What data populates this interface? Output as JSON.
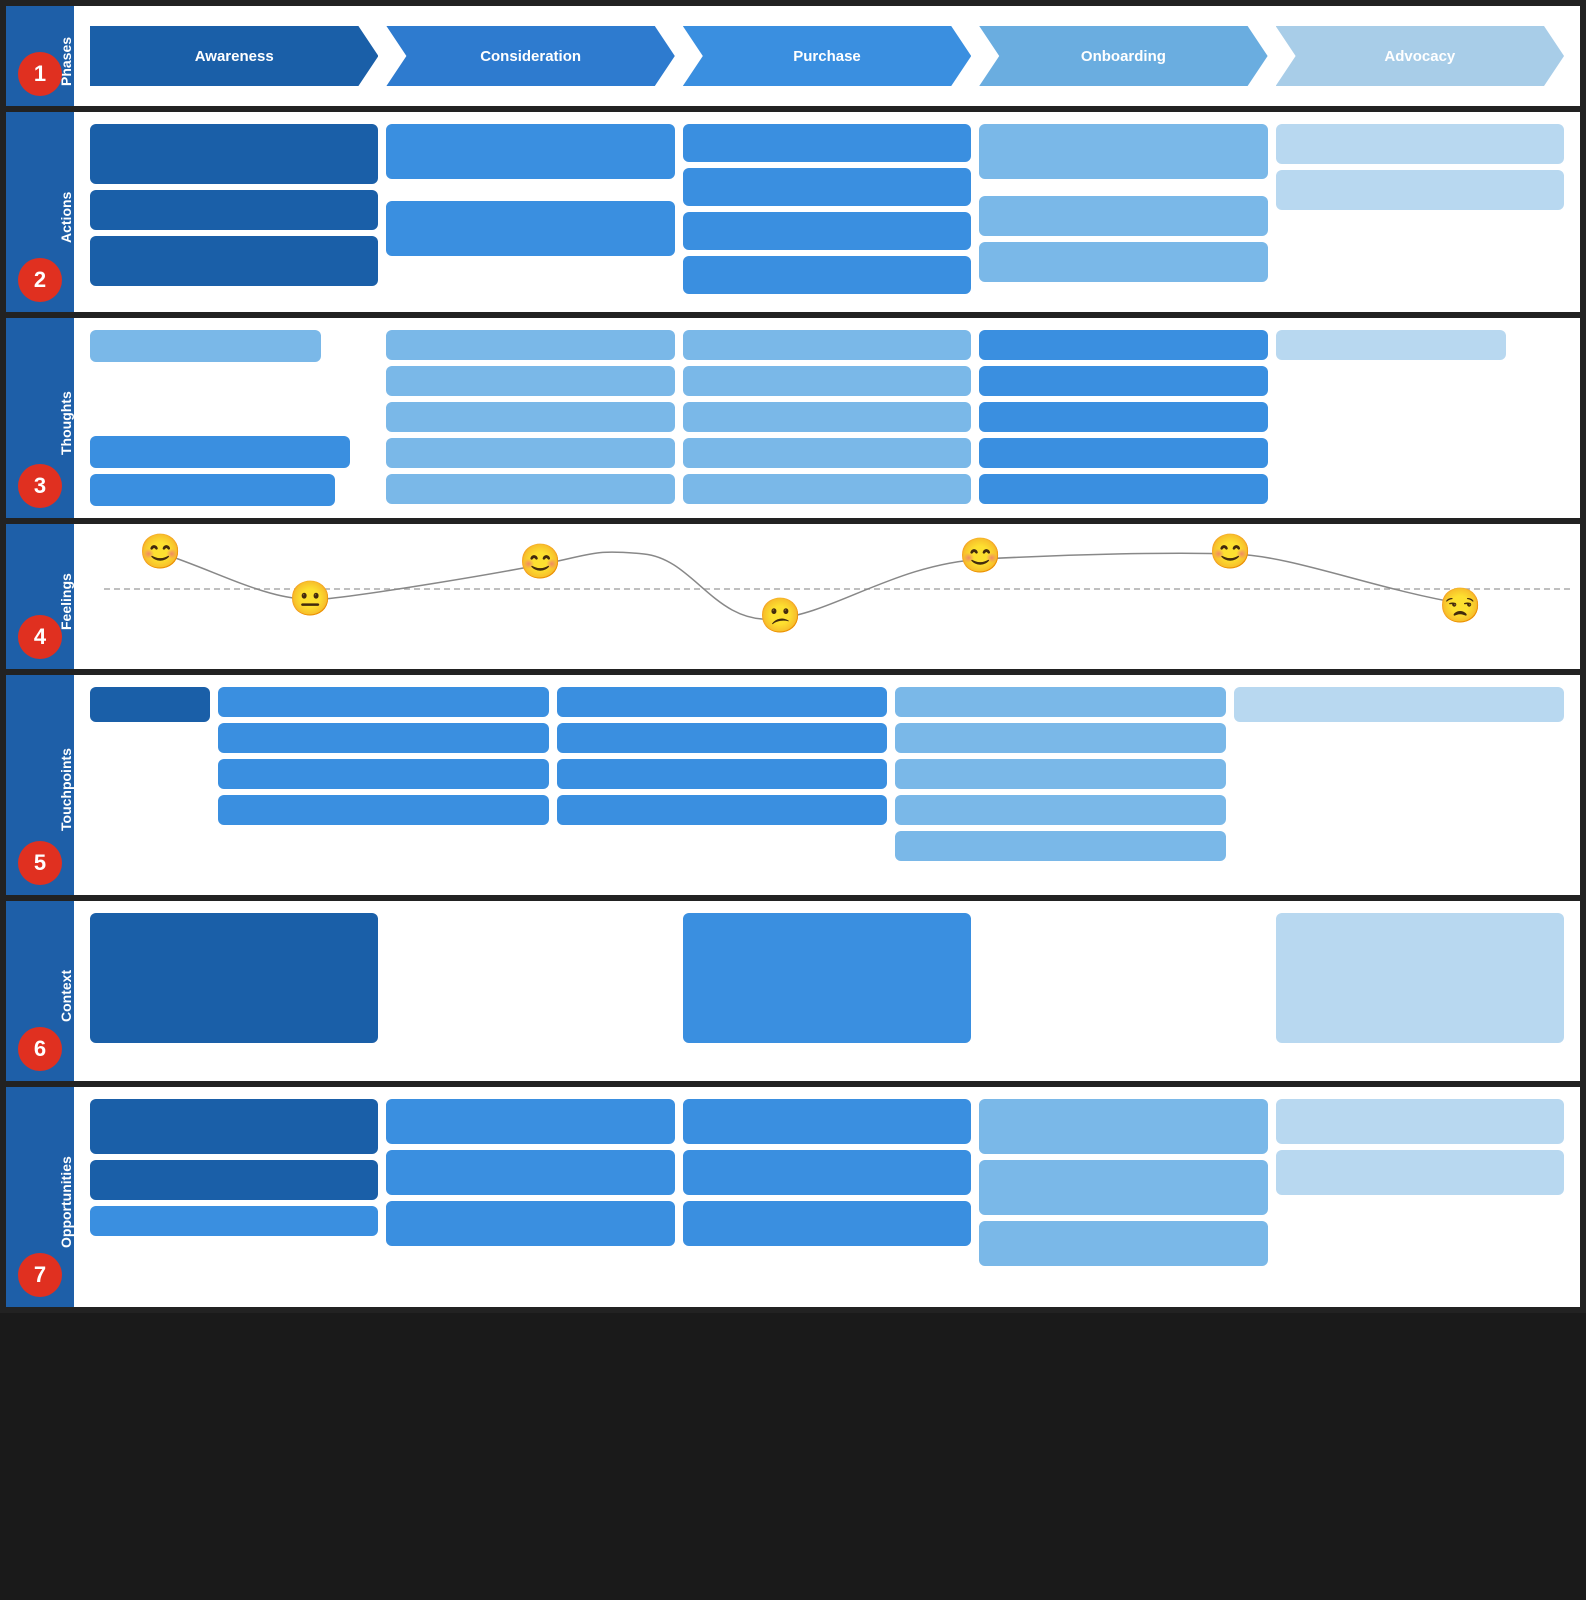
{
  "rows": [
    {
      "id": "phases",
      "number": "1",
      "label": "Phases",
      "phases": [
        {
          "label": "Awareness",
          "class": "phase-awareness"
        },
        {
          "label": "Consideration",
          "class": "phase-consideration"
        },
        {
          "label": "Purchase",
          "class": "phase-purchase"
        },
        {
          "label": "Onboarding",
          "class": "phase-onboarding"
        },
        {
          "label": "Advocacy",
          "class": "phase-advocacy"
        }
      ]
    },
    {
      "id": "actions",
      "number": "2",
      "label": "Actions"
    },
    {
      "id": "thoughts",
      "number": "3",
      "label": "Thoughts"
    },
    {
      "id": "feelings",
      "number": "4",
      "label": "Feelings"
    },
    {
      "id": "touchpoints",
      "number": "5",
      "label": "Touchpoints"
    },
    {
      "id": "context",
      "number": "6",
      "label": "Context"
    },
    {
      "id": "opportunities",
      "number": "7",
      "label": "Opportunities"
    }
  ]
}
